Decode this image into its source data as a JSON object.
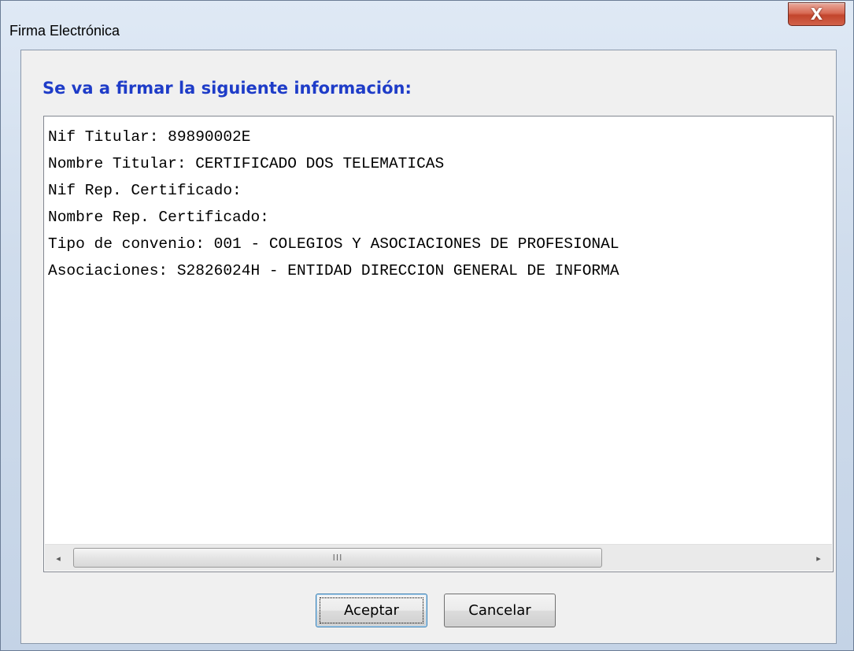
{
  "window": {
    "title": "Firma Electrónica",
    "close_label": "X"
  },
  "dialog": {
    "heading": "Se va a firmar la siguiente información:",
    "lines": [
      "Nif Titular: 89890002E",
      "Nombre Titular: CERTIFICADO DOS TELEMATICAS",
      "Nif Rep. Certificado:",
      "Nombre Rep. Certificado:",
      "Tipo de convenio: 001 - COLEGIOS Y ASOCIACIONES DE PROFESIONAL",
      "Asociaciones: S2826024H - ENTIDAD DIRECCION GENERAL DE INFORMA"
    ],
    "scrollbar": {
      "left_arrow": "◂",
      "right_arrow": "▸",
      "grip": "III"
    },
    "buttons": {
      "accept": "Aceptar",
      "cancel": "Cancelar"
    }
  },
  "colors": {
    "heading": "#1e3cc8",
    "close_button": "#c2452c",
    "focus_border": "#3c7fb1"
  },
  "icons": {
    "close": "close-icon",
    "scroll_left": "arrow-left-icon",
    "scroll_right": "arrow-right-icon"
  }
}
